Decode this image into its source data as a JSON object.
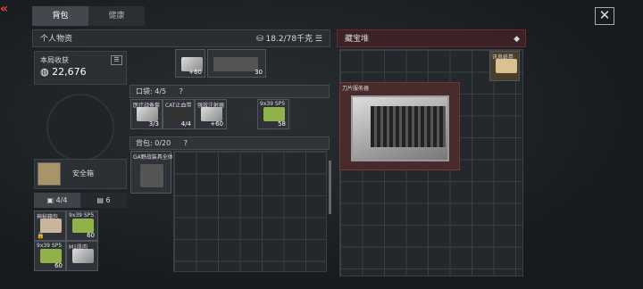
{
  "nav": {
    "back_icon": "«",
    "tabs": [
      "背包",
      "健康"
    ]
  },
  "close_icon": "✕",
  "personal": {
    "title": "个人物资",
    "weight": "18.2/78千克"
  },
  "earnings": {
    "label": "本局收获",
    "value": "22,676"
  },
  "top_items": [
    {
      "count": "+60"
    },
    {
      "count": "30"
    }
  ],
  "pocket": {
    "title": "口袋: 4/5",
    "help": "?",
    "items": [
      {
        "name": "医疗战备套",
        "count": "3/3"
      },
      {
        "name": "CAT止血带",
        "count": "4/4"
      },
      {
        "name": "强效注射器",
        "count": "+60"
      },
      {
        "name": "9x39 SP5",
        "count": "58"
      }
    ]
  },
  "backpack": {
    "title": "背包: 0/20",
    "help": "?",
    "item": {
      "name": "GA野战装具全体"
    }
  },
  "safebox": {
    "label": "安全箱"
  },
  "inv_tabs": {
    "a": "4/4",
    "b": "6"
  },
  "safe_items": [
    {
      "name": "神秘箱包",
      "count": ""
    },
    {
      "name": "9x39 SP5",
      "count": "60"
    },
    {
      "name": "9x39 SP5",
      "count": "60"
    },
    {
      "name": "M1肌肉",
      "count": ""
    }
  ],
  "stash": {
    "title": "藏宝堆",
    "items": [
      {
        "name": "讯息纸卷"
      },
      {
        "name": "刀片服务器"
      }
    ]
  }
}
